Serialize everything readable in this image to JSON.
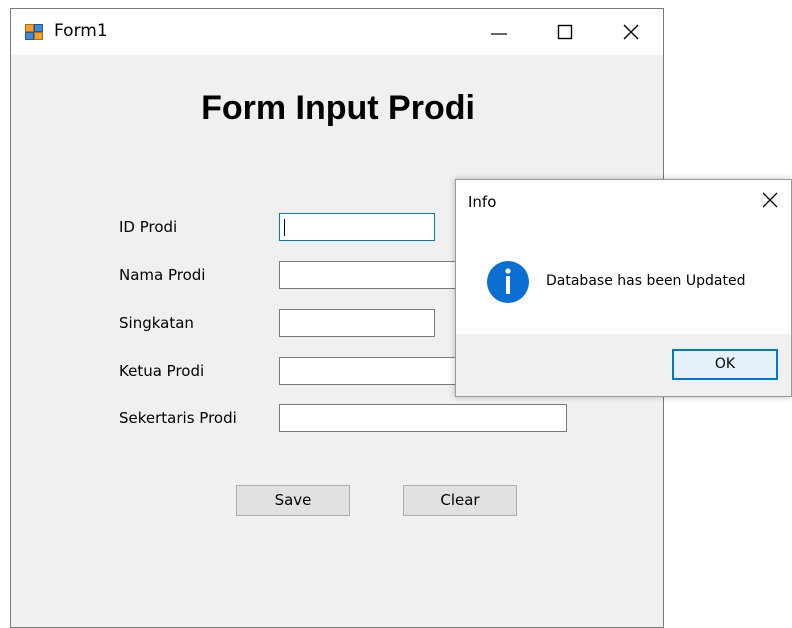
{
  "window": {
    "title": "Form1",
    "icon": "form-app-icon",
    "controls": {
      "minimize": "minimize-icon",
      "maximize": "maximize-icon",
      "close": "close-icon"
    }
  },
  "form": {
    "heading": "Form Input Prodi",
    "fields": [
      {
        "label": "ID Prodi",
        "value": "",
        "focused": true
      },
      {
        "label": "Nama Prodi",
        "value": ""
      },
      {
        "label": "Singkatan",
        "value": ""
      },
      {
        "label": "Ketua Prodi",
        "value": ""
      },
      {
        "label": "Sekertaris Prodi",
        "value": ""
      }
    ],
    "save_label": "Save",
    "clear_label": "Clear"
  },
  "dialog": {
    "title": "Info",
    "icon": "info-icon",
    "message": "Database has been Updated",
    "ok_label": "OK",
    "accent": "#0078d7",
    "icon_color": "#0a6fd1"
  }
}
